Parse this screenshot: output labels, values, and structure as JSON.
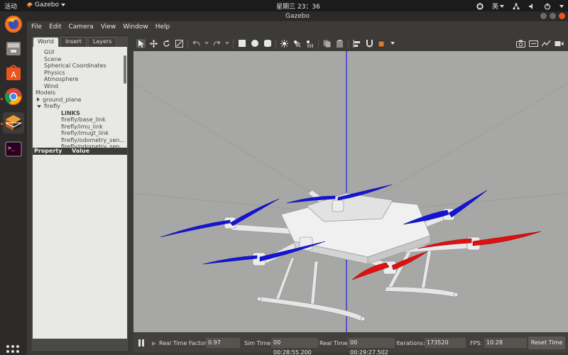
{
  "topbar": {
    "activities": "活动",
    "app_menu": "Gazebo",
    "clock": "星期三 23：36",
    "input_method": "英"
  },
  "dock": {
    "items": [
      {
        "name": "Firefox",
        "icon": "firefox-icon"
      },
      {
        "name": "Files",
        "icon": "files-icon"
      },
      {
        "name": "Ubuntu Software",
        "icon": "software-icon"
      },
      {
        "name": "Chrome",
        "icon": "chrome-icon"
      },
      {
        "name": "Gazebo",
        "icon": "gazebo-icon"
      },
      {
        "name": "Terminal",
        "icon": "terminal-icon"
      }
    ]
  },
  "window": {
    "title": "Gazebo",
    "menu": [
      "File",
      "Edit",
      "Camera",
      "View",
      "Window",
      "Help"
    ]
  },
  "left_panel": {
    "tabs": [
      "World",
      "Insert",
      "Layers"
    ],
    "active_tab": "World",
    "tree": [
      {
        "label": "GUI",
        "indent": 1
      },
      {
        "label": "Scene",
        "indent": 1
      },
      {
        "label": "Spherical Coordinates",
        "indent": 1
      },
      {
        "label": "Physics",
        "indent": 1
      },
      {
        "label": "Atmosphere",
        "indent": 1
      },
      {
        "label": "Wind",
        "indent": 1
      },
      {
        "label": "Models",
        "indent": 0,
        "expander": "down"
      },
      {
        "label": "ground_plane",
        "indent": 1,
        "expander": "right"
      },
      {
        "label": "firefly",
        "indent": 1,
        "expander": "down"
      },
      {
        "label": "LINKS",
        "indent": 3,
        "bold": true
      },
      {
        "label": "firefly/base_link",
        "indent": 3
      },
      {
        "label": "firefly/imu_link",
        "indent": 3
      },
      {
        "label": "firefly/imugt_link",
        "indent": 3
      },
      {
        "label": "firefly/odometry_sen...",
        "indent": 3
      },
      {
        "label": "firefly/odometry_sen...",
        "indent": 3
      }
    ],
    "property_header": {
      "property": "Property",
      "value": "Value"
    }
  },
  "bottom_bar": {
    "rtf_label": "Real Time Factor:",
    "rtf_value": "0.97",
    "sim_time_label": "Sim Time:",
    "sim_time_value": "00 00:28:55.200",
    "real_time_label": "Real Time:",
    "real_time_value": "00 00:29:27.502",
    "iterations_label": "Iterations:",
    "iterations_value": "173520",
    "fps_label": "FPS:",
    "fps_value": "10.28",
    "reset_label": "Reset Time"
  },
  "colors": {
    "accent": "#e95420",
    "viewport_bg": "#a7a7a6",
    "propeller_blue": "#1414d8",
    "propeller_red": "#e01010"
  }
}
